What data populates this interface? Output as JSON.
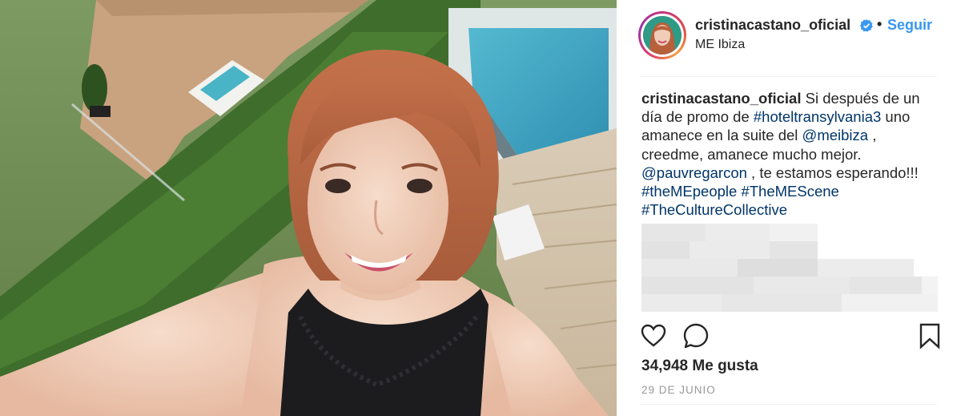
{
  "post": {
    "author": {
      "username": "cristinacastano_oficial",
      "verified": true,
      "follow_label": "Seguir",
      "separator": "•",
      "location": "ME Ibiza"
    },
    "caption": {
      "username": "cristinacastano_oficial",
      "segments": [
        {
          "type": "text",
          "value": " Si después de un día de promo de "
        },
        {
          "type": "hashtag",
          "value": "#hoteltransylvania3"
        },
        {
          "type": "text",
          "value": " uno amanece en la suite del "
        },
        {
          "type": "mention",
          "value": "@meibiza"
        },
        {
          "type": "text",
          "value": " , creedme, amanece mucho mejor. "
        },
        {
          "type": "mention",
          "value": "@pauvregarcon"
        },
        {
          "type": "text",
          "value": " , te estamos esperando!!! "
        },
        {
          "type": "hashtag",
          "value": "#theMEpeople"
        },
        {
          "type": "text",
          "value": " "
        },
        {
          "type": "hashtag",
          "value": "#TheMEScene"
        },
        {
          "type": "text",
          "value": " "
        },
        {
          "type": "hashtag",
          "value": "#TheCultureCollective"
        }
      ]
    },
    "likes_label": "34,948 Me gusta",
    "date_label": "29 DE JUNIO",
    "colors": {
      "link": "#003569",
      "follow": "#3897f0",
      "text": "#262626",
      "muted": "#999999"
    },
    "icons": {
      "like": "heart-outline-icon",
      "comment": "comment-bubble-icon",
      "save": "bookmark-outline-icon",
      "verified": "verified-badge-icon"
    }
  }
}
